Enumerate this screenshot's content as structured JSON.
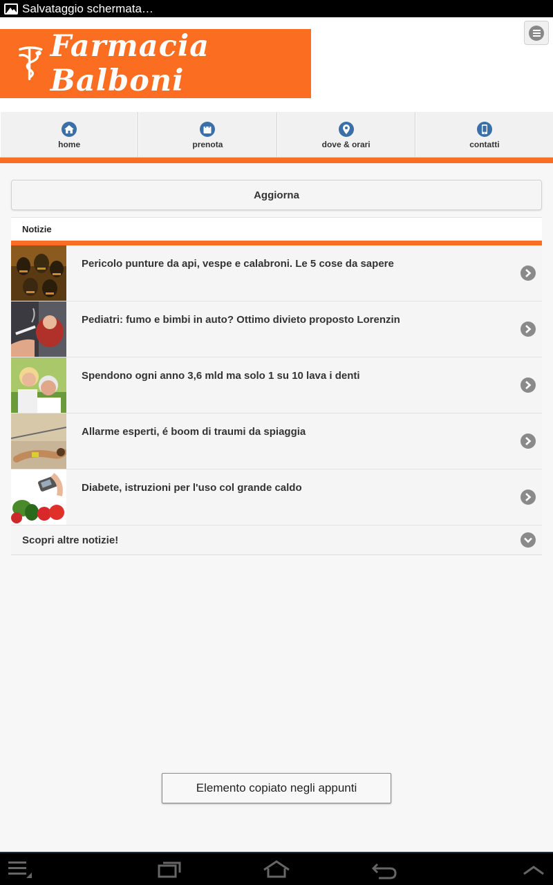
{
  "statusbar": {
    "text": "Salvataggio schermata…",
    "icon": "image-icon"
  },
  "header": {
    "brand": "Farmacia Balboni",
    "brand_color": "#fb6d21",
    "menu_icon": "menu-icon"
  },
  "nav": {
    "items": [
      {
        "label": "home",
        "icon": "home-icon"
      },
      {
        "label": "prenota",
        "icon": "bag-icon"
      },
      {
        "label": "dove & orari",
        "icon": "map-pin-icon"
      },
      {
        "label": "contatti",
        "icon": "phone-icon"
      }
    ],
    "icon_color": "#3a6fa8"
  },
  "refresh": {
    "label": "Aggiorna"
  },
  "news": {
    "heading": "Notizie",
    "items": [
      {
        "title": "Pericolo punture da api, vespe e calabroni. Le 5 cose da sapere",
        "thumb": "bees-photo"
      },
      {
        "title": "Pediatri: fumo e bimbi in auto? Ottimo divieto proposto Lorenzin",
        "thumb": "child-in-car-photo"
      },
      {
        "title": "Spendono ogni anno 3,6 mld ma solo 1 su 10 lava i denti",
        "thumb": "smiling-couple-photo"
      },
      {
        "title": "Allarme esperti, é boom di traumi da spiaggia",
        "thumb": "beach-photo"
      },
      {
        "title": "Diabete, istruzioni per l'uso col grande caldo",
        "thumb": "vegetables-glucometer-photo"
      }
    ],
    "more_label": "Scopri altre notizie!"
  },
  "toast": {
    "text": "Elemento copiato negli appunti"
  },
  "system_nav": {
    "buttons": [
      "menu-icon",
      "recent-apps-icon",
      "home-icon",
      "back-icon",
      "up-chevron-icon"
    ]
  }
}
